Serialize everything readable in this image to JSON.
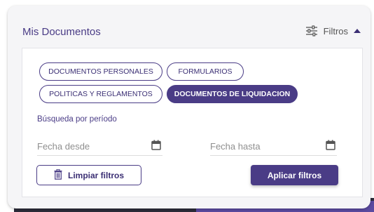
{
  "card": {
    "title": "Mis Documentos"
  },
  "filters": {
    "toggle_label": "Filtros"
  },
  "chips": [
    {
      "label": "DOCUMENTOS PERSONALES",
      "active": false
    },
    {
      "label": "FORMULARIOS",
      "active": false
    },
    {
      "label": "POLITICAS Y REGLAMENTOS",
      "active": false
    },
    {
      "label": "DOCUMENTOS DE LIQUIDACION",
      "active": true
    }
  ],
  "search": {
    "period_label": "Búsqueda por período"
  },
  "date_from": {
    "placeholder": "Fecha desde"
  },
  "date_to": {
    "placeholder": "Fecha hasta"
  },
  "buttons": {
    "clear": "Limpiar filtros",
    "apply": "Aplicar filtros"
  },
  "colors": {
    "accent": "#4a3c86",
    "panel": "#ffffff",
    "card": "#f5f5f7"
  },
  "icons": {
    "filter": "tune-icon",
    "collapse": "caret-up-icon",
    "calendar": "calendar-icon",
    "clear": "trash-icon"
  }
}
